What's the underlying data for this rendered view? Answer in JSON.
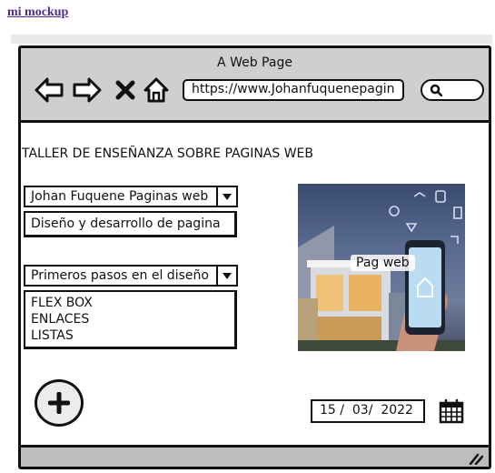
{
  "top_link": {
    "label": "mi mockup"
  },
  "window": {
    "title": "A Web Page"
  },
  "toolbar": {
    "back_icon": "back-arrow-icon",
    "forward_icon": "forward-arrow-icon",
    "close_icon": "close-icon",
    "home_icon": "home-icon",
    "search_icon": "search-icon",
    "url": "https://www.Johanfuquenepagin"
  },
  "page": {
    "heading": "TALLER DE ENSEÑANZA SOBRE PAGINAS WEB",
    "select1": {
      "value": "Johan Fuquene Paginas web"
    },
    "list1": {
      "items": [
        "Diseño y desarrollo de pagina"
      ]
    },
    "select2": {
      "value": "Primeros pasos en el diseño"
    },
    "list2": {
      "items": [
        "FLEX BOX",
        "ENLACES",
        "LISTAS"
      ]
    },
    "image": {
      "label": "Pag web"
    },
    "add_icon": "plus-icon",
    "date": "15 /  03/  2022",
    "calendar_icon": "calendar-icon"
  },
  "colors": {
    "chrome": "#cfcfcf",
    "status_bar": "#bdbdbd",
    "link": "#4a2d84",
    "border": "#111111"
  }
}
